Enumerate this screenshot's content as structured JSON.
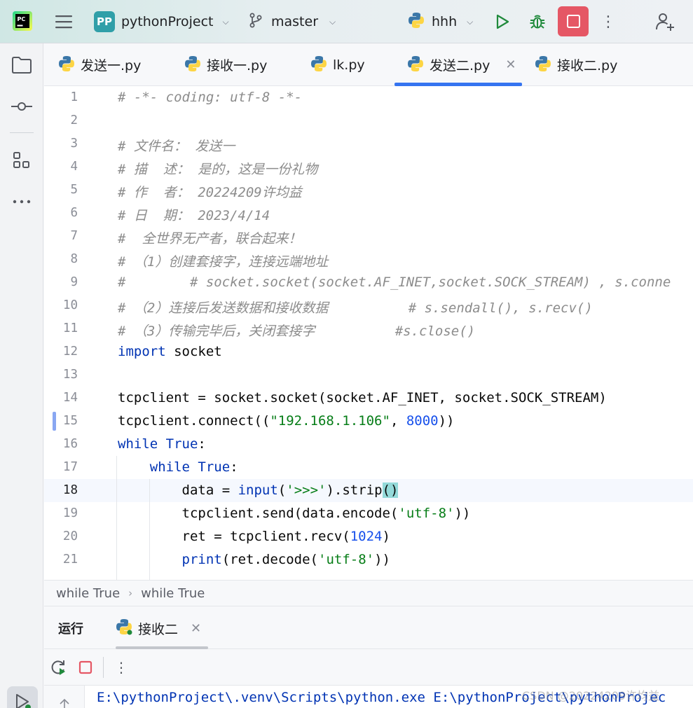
{
  "titlebar": {
    "project_badge": "PP",
    "project_name": "pythonProject",
    "branch": "master",
    "run_config": "hhh"
  },
  "editor_tabs": [
    {
      "label": "发送一.py",
      "active": false
    },
    {
      "label": "接收一.py",
      "active": false
    },
    {
      "label": "lk.py",
      "active": false
    },
    {
      "label": "发送二.py",
      "active": true
    },
    {
      "label": "接收二.py",
      "active": false
    }
  ],
  "code": {
    "current_line": 18,
    "lines": [
      {
        "n": "1",
        "text": "# -*- coding: utf-8 -*-"
      },
      {
        "n": "2",
        "text": ""
      },
      {
        "n": "3",
        "text": "# 文件名： 发送一"
      },
      {
        "n": "4",
        "text": "# 描  述： 是的，这是一份礼物"
      },
      {
        "n": "5",
        "text": "# 作  者： 20224209许均益"
      },
      {
        "n": "6",
        "text": "# 日  期： 2023/4/14"
      },
      {
        "n": "7",
        "text": "#  全世界无产者，联合起来！"
      },
      {
        "n": "8",
        "text": "# （1）创建套接字，连接远端地址"
      },
      {
        "n": "9",
        "text": "#        # socket.socket(socket.AF_INET,socket.SOCK_STREAM) , s.conne"
      },
      {
        "n": "10",
        "text": "# （2）连接后发送数据和接收数据          # s.sendall(), s.recv()"
      },
      {
        "n": "11",
        "text": "# （3）传输完毕后，关闭套接字          #s.close()"
      },
      {
        "n": "12",
        "text": "import socket"
      },
      {
        "n": "13",
        "text": ""
      },
      {
        "n": "14",
        "text": "tcpclient = socket.socket(socket.AF_INET, socket.SOCK_STREAM)"
      },
      {
        "n": "15",
        "text": "tcpclient.connect((\"192.168.1.106\", 8000))"
      },
      {
        "n": "16",
        "text": "while True:"
      },
      {
        "n": "17",
        "text": "    while True:"
      },
      {
        "n": "18",
        "text": "        data = input('>>>').strip()"
      },
      {
        "n": "19",
        "text": "        tcpclient.send(data.encode('utf-8'))"
      },
      {
        "n": "20",
        "text": "        ret = tcpclient.recv(1024)"
      },
      {
        "n": "21",
        "text": "        print(ret.decode('utf-8'))"
      }
    ]
  },
  "breadcrumb": [
    "while True",
    "while True"
  ],
  "run_panel": {
    "title": "运行",
    "tab_label": "接收二",
    "console_line": "E:\\pythonProject\\.venv\\Scripts\\python.exe E:\\pythonProject\\pythonProjec"
  },
  "watermark": "CSDN @20224209许均益",
  "colors": {
    "accent": "#3574f0",
    "stop": "#e55765",
    "run": "#208a3c",
    "keyword": "#0033b3",
    "string": "#067d17",
    "number": "#1750eb",
    "comment": "#8c8c8c"
  },
  "icons": {
    "app": "pycharm-logo-icon",
    "menu": "hamburger-icon",
    "branch": "git-branch-icon",
    "run": "play-icon",
    "debug": "bug-icon",
    "stop": "stop-icon",
    "more": "more-vertical-icon",
    "add_user": "add-user-icon",
    "project_tool": "folder-icon",
    "commit_tool": "commit-icon",
    "structure_tool": "structure-icon",
    "more_tools": "more-horizontal-icon",
    "run_tool": "run-tool-icon",
    "python_file": "python-file-icon",
    "rerun": "rerun-icon",
    "scroll_up": "scroll-up-icon"
  }
}
